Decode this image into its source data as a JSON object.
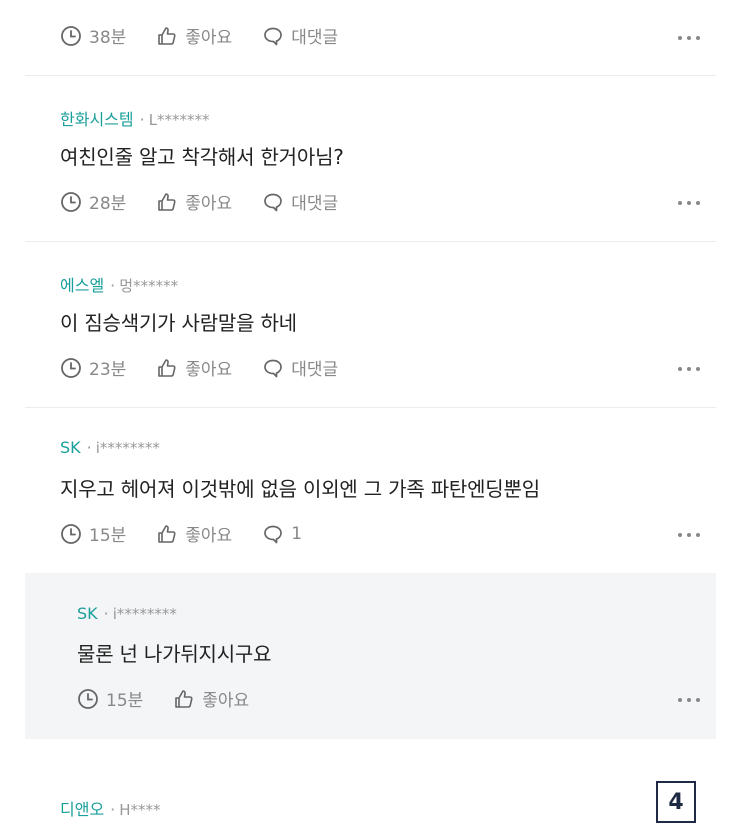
{
  "comments": [
    {
      "time": "38분",
      "like_label": "좋아요",
      "reply_label": "대댓글"
    },
    {
      "author": "한화시스템",
      "user": "L*******",
      "text": "여친인줄 알고 착각해서 한거아님?",
      "time": "28분",
      "like_label": "좋아요",
      "reply_label": "대댓글"
    },
    {
      "author": "에스엘",
      "user": "멍******",
      "text": "이 짐승색기가 사람말을 하네",
      "time": "23분",
      "like_label": "좋아요",
      "reply_label": "대댓글"
    },
    {
      "author": "SK",
      "user": "i********",
      "text": "지우고 헤어져 이것밖에 없음 이외엔 그 가족 파탄엔딩뿐임",
      "time": "15분",
      "like_label": "좋아요",
      "reply_label": "1"
    },
    {
      "author": "SK",
      "user": "i********",
      "text": "물론 넌 나가뒤지시구요",
      "time": "15분",
      "like_label": "좋아요"
    },
    {
      "author": "디앤오",
      "user": "H****"
    }
  ],
  "separator": "·",
  "page_number": "4",
  "icons": {
    "time": "clock-icon",
    "like": "thumbs-up-icon",
    "reply": "speech-bubble-icon",
    "more": "more-dots-icon"
  },
  "colors": {
    "author": "#1a9f9a",
    "muted": "#888888",
    "reply_bg": "#f4f5f7"
  }
}
